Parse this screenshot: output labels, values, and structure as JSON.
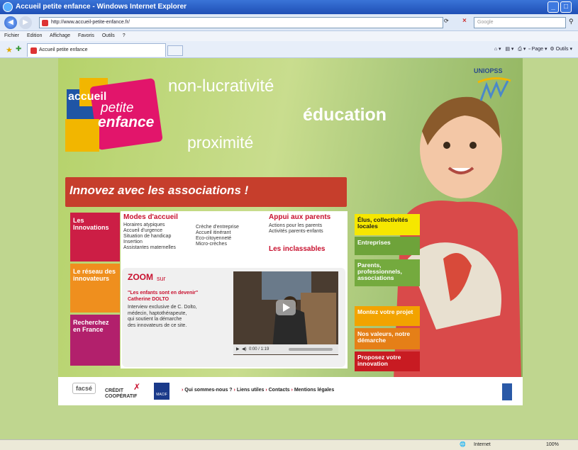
{
  "window": {
    "title": "Accueil petite enfance - Windows Internet Explorer"
  },
  "address": {
    "url": "http://www.accueil-petite-enfance.fr/",
    "search_placeholder": "Google"
  },
  "menu": [
    "Fichier",
    "Edition",
    "Affichage",
    "Favoris",
    "Outils",
    "?"
  ],
  "tab": {
    "label": "Accueil petite enfance"
  },
  "tools": {
    "page": "Page",
    "outils": "Outils"
  },
  "site": {
    "logo": {
      "line1": "accueil",
      "line2": "petite",
      "line3": "enfance"
    },
    "words": [
      "non-lucrativité",
      "éducation",
      "proximité"
    ],
    "uniopss": "UNIOPSS",
    "banner": "Innovez avec les associations !",
    "nav": {
      "innovations": "Les Innovations",
      "reseau": "Le réseau des innovateurs",
      "recherchez": "Recherchez en France"
    },
    "modes": {
      "heading": "Modes d'accueil",
      "col1": [
        "Horaires atypiques",
        "Accueil d'urgence",
        "Situation de handicap",
        "Insertion",
        "Assistantes maternelles"
      ],
      "col2": [
        "Crèche d'entreprise",
        "Accueil itinérant",
        "Eco-citoyenneté",
        "Micro-crèches"
      ]
    },
    "appui": {
      "heading": "Appui aux parents",
      "items": [
        "Actions pour les parents",
        "Activités parents-enfants"
      ]
    },
    "inclassables": "Les inclassables",
    "zoom": {
      "title": "ZOOM",
      "sur": "sur",
      "quote": "\"Les enfants sont en devenir\"",
      "author": "Catherine DOLTO",
      "desc": [
        "Interview exclusive de C. Dolto,",
        "médecin, haptothérapeute,",
        "qui soutient la démarche",
        "des innovateurs de ce site."
      ],
      "time": "0:00 / 1:19"
    },
    "right_tiles": [
      "Élus, collectivités locales",
      "Entreprises",
      "Parents, professionnels, associations",
      "Montez votre projet",
      "Nos valeurs, notre démarche",
      "Proposez votre innovation"
    ],
    "footer": {
      "facse": "facsé",
      "credit": "CRÉDIT COOPÉRATIF",
      "macif": "MACIF",
      "links": [
        "Qui sommes-nous ?",
        "Liens utiles",
        "Contacts",
        "Mentions légales"
      ]
    }
  },
  "status": {
    "zone": "Internet",
    "zoom": "100%"
  },
  "colors": {
    "banner": "#c63e2c",
    "red": "#c8102e",
    "bg": "#bfd68f"
  }
}
